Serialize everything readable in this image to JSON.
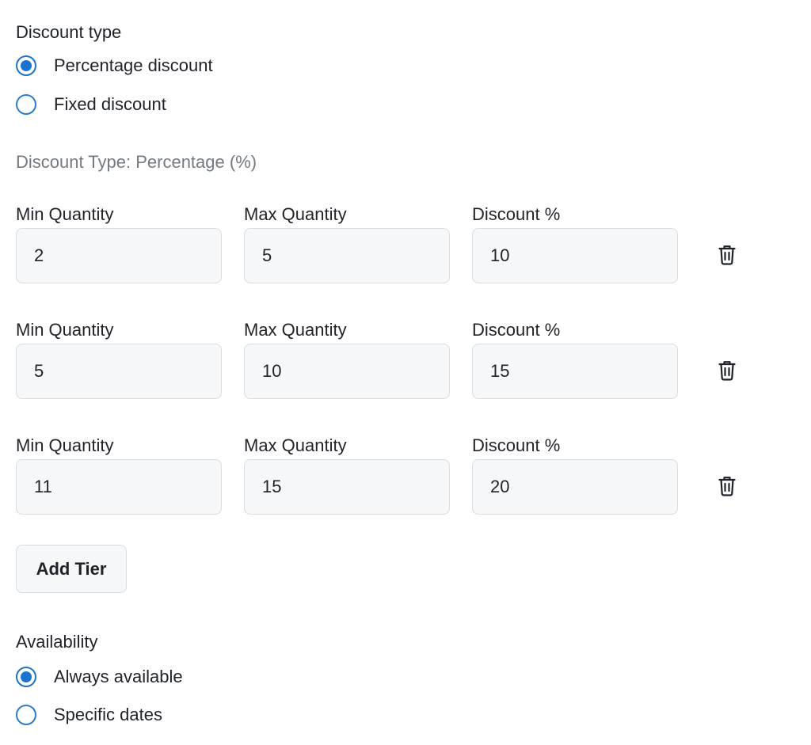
{
  "discount_type": {
    "title": "Discount type",
    "options": [
      {
        "label": "Percentage discount",
        "checked": true
      },
      {
        "label": "Fixed discount",
        "checked": false
      }
    ]
  },
  "tiers_section": {
    "subtitle": "Discount Type: Percentage (%)",
    "columns": {
      "min": "Min Quantity",
      "max": "Max Quantity",
      "discount": "Discount %"
    },
    "tiers": [
      {
        "min": "2",
        "max": "5",
        "discount": "10"
      },
      {
        "min": "5",
        "max": "10",
        "discount": "15"
      },
      {
        "min": "11",
        "max": "15",
        "discount": "20"
      }
    ],
    "add_label": "Add Tier",
    "delete_icon": "trash-icon"
  },
  "availability": {
    "title": "Availability",
    "options": [
      {
        "label": "Always available",
        "checked": true
      },
      {
        "label": "Specific dates",
        "checked": false
      }
    ]
  },
  "colors": {
    "accent": "#1a73d0",
    "field_bg": "#f6f7f9",
    "field_border": "#d8dde3",
    "muted_text": "#747a82"
  }
}
